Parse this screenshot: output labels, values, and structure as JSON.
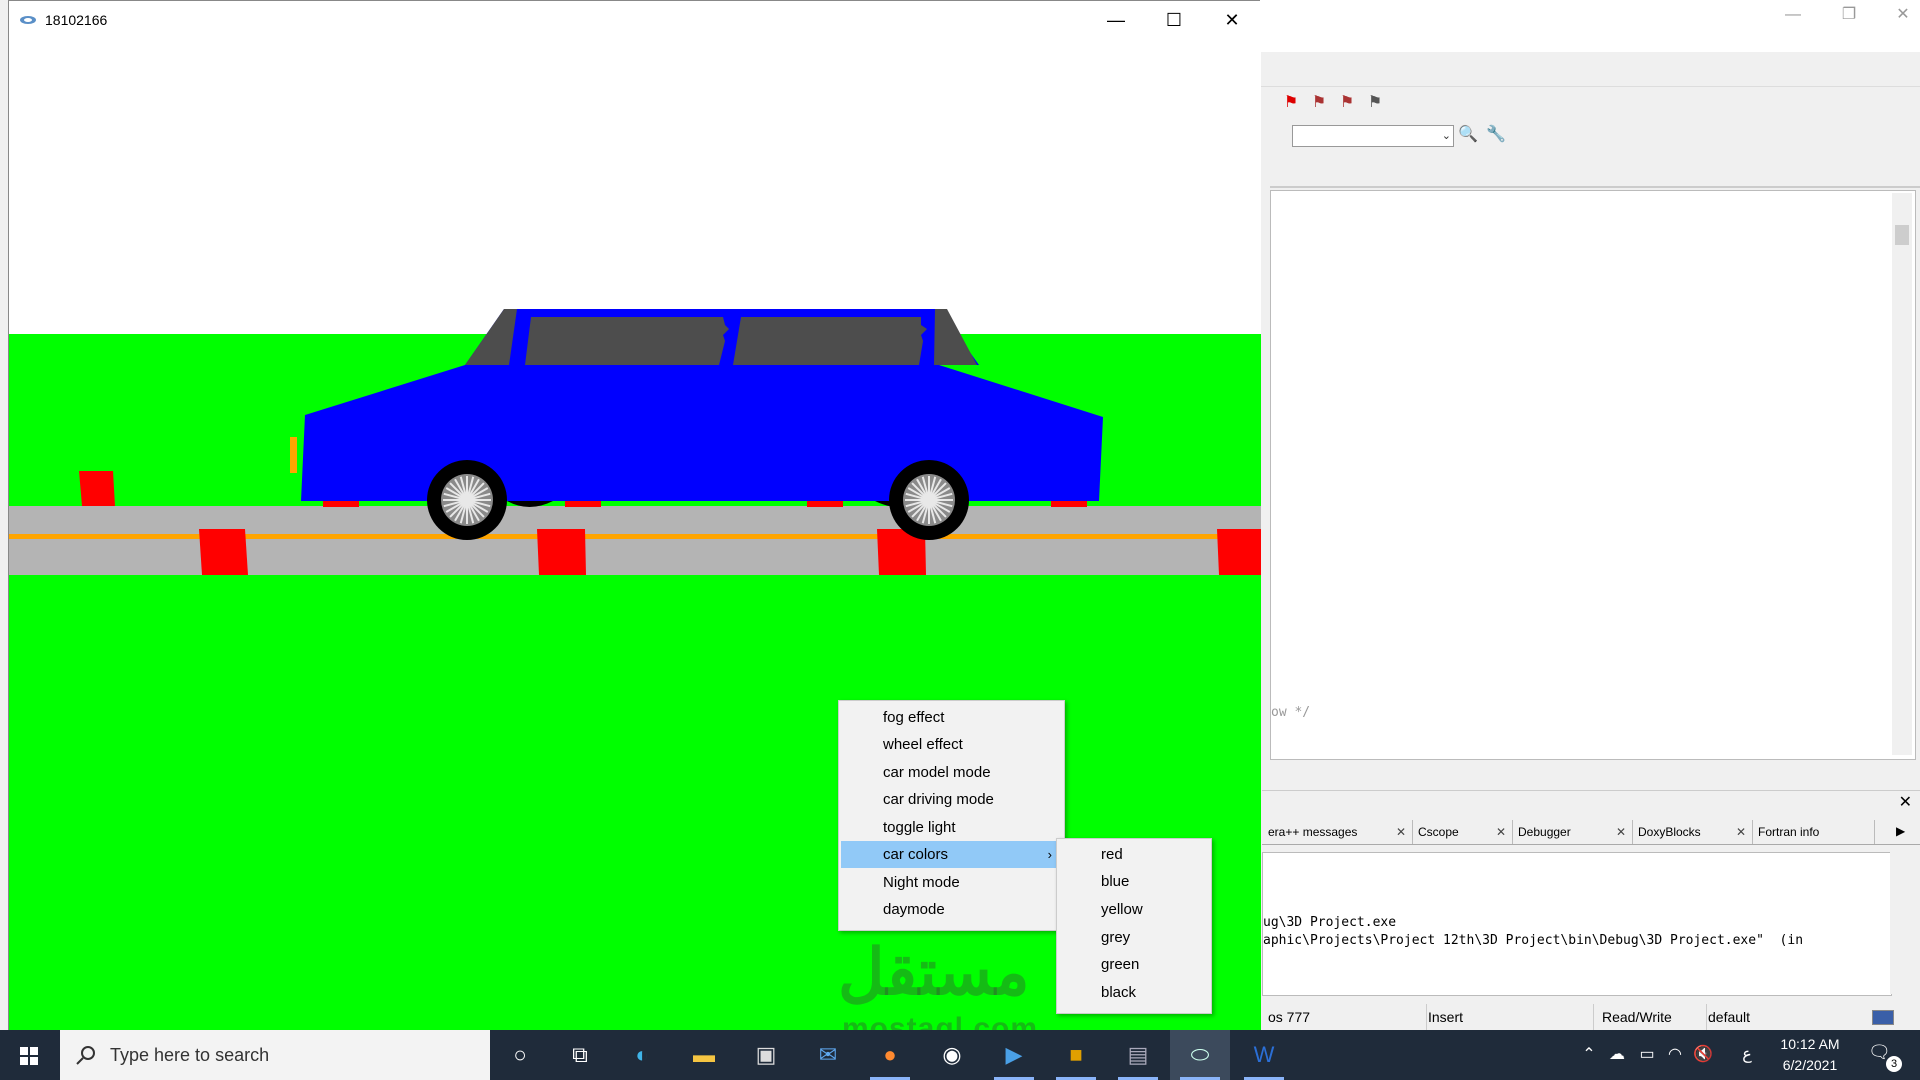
{
  "app_window": {
    "title": "18102166",
    "minimize_glyph": "—",
    "maximize_glyph": "☐",
    "close_glyph": "✕"
  },
  "scene": {
    "sky_color": "#ffffff",
    "grass_color": "#00ff00",
    "road_color": "#b4b4b4",
    "lane_color": "#ffa500",
    "car_color": "#0000ff",
    "window_color": "#4d4d4d",
    "block_color": "#ff0000"
  },
  "context_menu": {
    "items": [
      {
        "label": "fog effect"
      },
      {
        "label": "wheel effect"
      },
      {
        "label": "car model mode"
      },
      {
        "label": "car driving mode"
      },
      {
        "label": "toggle light"
      },
      {
        "label": "car colors",
        "submenu_arrow": "›"
      },
      {
        "label": "Night mode"
      },
      {
        "label": "daymode"
      }
    ],
    "submenu": {
      "items": [
        {
          "label": "red"
        },
        {
          "label": "blue"
        },
        {
          "label": "yellow"
        },
        {
          "label": "grey"
        },
        {
          "label": "green"
        },
        {
          "label": "black"
        }
      ]
    }
  },
  "ide": {
    "code_fragment": "ow */",
    "log_tabs": [
      {
        "label": "era++ messages"
      },
      {
        "label": "Cscope"
      },
      {
        "label": "Debugger"
      },
      {
        "label": "DoxyBlocks"
      },
      {
        "label": "Fortran info"
      }
    ],
    "log_lines": [
      "ug\\3D Project.exe",
      "aphic\\Projects\\Project 12th\\3D Project\\bin\\Debug\\3D Project.exe\"  (in"
    ],
    "status": {
      "position": "os 777",
      "mode": "Insert",
      "access": "Read/Write",
      "profile": "default"
    }
  },
  "watermark": {
    "logo": "مستقل",
    "text": "mostaql.com"
  },
  "taskbar": {
    "search_placeholder": "Type here to search",
    "time": "10:12 AM",
    "date": "6/2/2021",
    "notification_count": "3",
    "language_indicator": "ع"
  }
}
